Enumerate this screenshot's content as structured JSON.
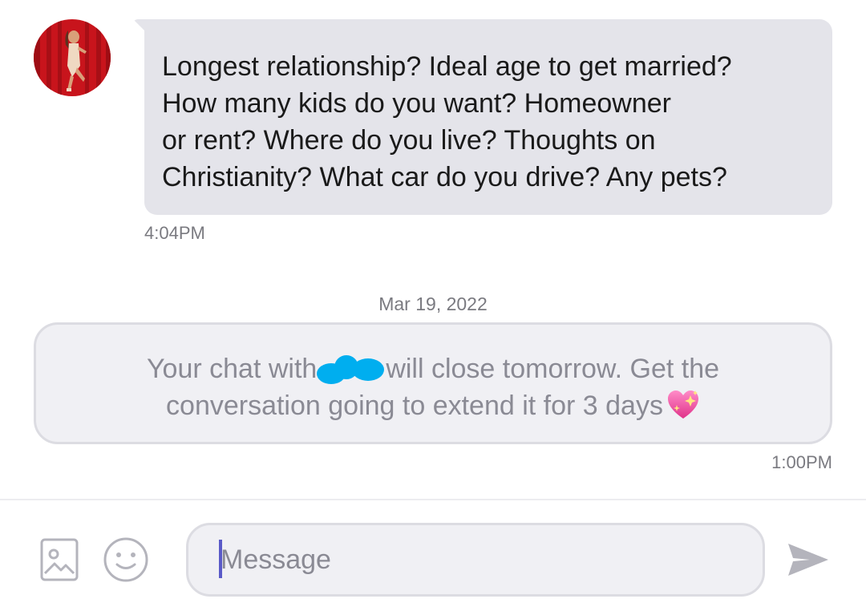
{
  "conversation": {
    "incoming_message": {
      "avatar_icon": "profile-photo",
      "text": "Longest relationship? Ideal age to get married?\nHow many kids do you want? Homeowner\nor rent? Where do you live? Thoughts on\nChristianity? What car do you drive? Any pets?",
      "timestamp": "4:04PM"
    },
    "date_separator": "Mar 19, 2022",
    "system_notice": {
      "text_before_name": "Your chat with",
      "text_after_name": "will close tomorrow. Get the",
      "line2": "conversation going to extend it for 3 days",
      "emoji_icon": "sparkling-heart-icon",
      "timestamp": "1:00PM"
    }
  },
  "composer": {
    "image_button_icon": "image-icon",
    "emoji_button_icon": "smiley-icon",
    "placeholder": "Message",
    "value": "",
    "send_button_icon": "send-icon"
  },
  "colors": {
    "bubble_incoming": "#e4e4ea",
    "notice_background": "#f0f0f4",
    "notice_border": "#dcdce2",
    "redaction": "#00aeef",
    "caret": "#5a5ac8",
    "icon_gray": "#b4b4bc"
  }
}
